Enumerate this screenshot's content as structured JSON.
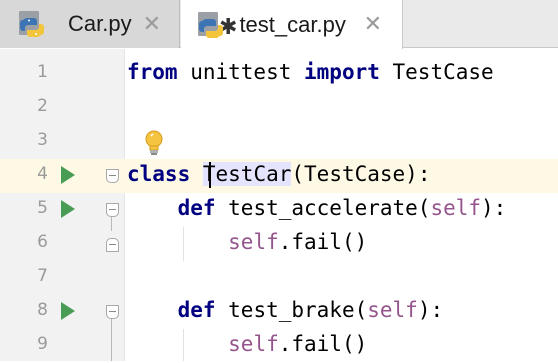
{
  "tabs": [
    {
      "label": "Car.py",
      "close": "✕",
      "icon": "python-file-icon",
      "active": false
    },
    {
      "label": "test_car.py",
      "close": "✕",
      "icon": "python-test-file-icon",
      "active": true
    }
  ],
  "editor": {
    "line_numbers": [
      "1",
      "2",
      "3",
      "4",
      "5",
      "6",
      "7",
      "8",
      "9"
    ],
    "lines": [
      {
        "from": "from",
        "mod": " unittest ",
        "import": "import",
        "name": " TestCase"
      },
      {},
      {},
      {
        "class": "class",
        "space": " ",
        "name": "TestCar",
        "rest": "(TestCase):"
      },
      {
        "indent": "    ",
        "def": "def",
        "name": " test_accelerate(",
        "self": "self",
        "end": "):"
      },
      {
        "indent": "        ",
        "self": "self",
        "rest": ".fail()"
      },
      {},
      {
        "indent": "    ",
        "def": "def",
        "name": " test_brake(",
        "self": "self",
        "end": "):"
      },
      {
        "indent": "        ",
        "self": "self",
        "rest": ".fail()"
      }
    ],
    "current_line": "4",
    "intention_icon": "lightbulb-icon",
    "run_icon": "run-test-icon"
  },
  "colors": {
    "keyword": "#000080",
    "self": "#94558d",
    "run_green": "#499c54",
    "current_line_bg": "#fdf9e4",
    "identifier_highlight": "#e4e4ff"
  }
}
